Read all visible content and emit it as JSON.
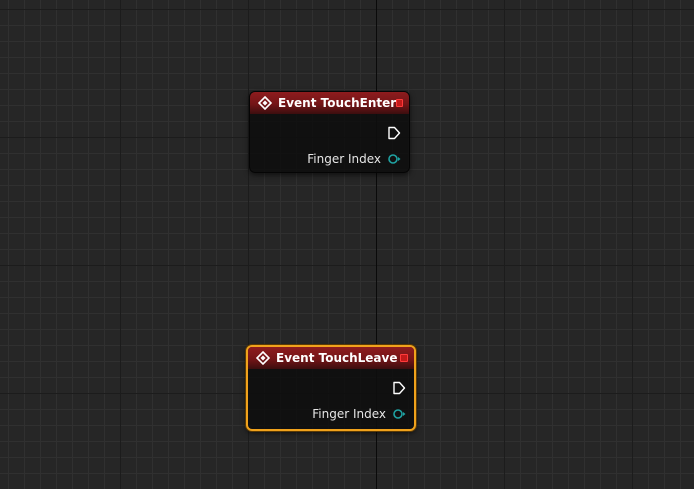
{
  "nodes": [
    {
      "title": "Event TouchEnter",
      "selected": false,
      "pins": {
        "finger_index_label": "Finger Index"
      }
    },
    {
      "title": "Event TouchLeave",
      "selected": true,
      "pins": {
        "finger_index_label": "Finger Index"
      }
    }
  ],
  "colors": {
    "header": "#8e1c1e",
    "selection": "#f0a21c",
    "data_pin": "#1fa3a3",
    "delegate_pin": "#c41a1a",
    "exec_pin": "#ffffff"
  },
  "icons": {
    "event": "diamond-event-icon",
    "exec": "exec-pin-icon",
    "data": "integer-pin-icon",
    "delegate": "delegate-pin-icon"
  }
}
